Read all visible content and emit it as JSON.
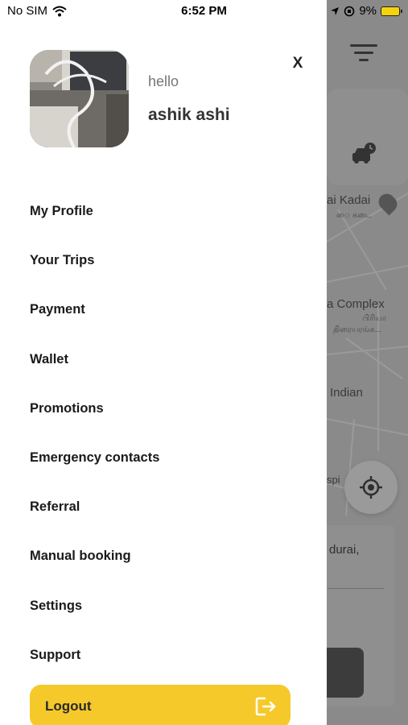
{
  "status_bar": {
    "carrier": "No SIM",
    "time": "6:52 PM",
    "battery": "9%"
  },
  "drawer": {
    "close_label": "X",
    "greeting": "hello",
    "user_name": "ashik ashi",
    "menu_items": [
      {
        "label": "My Profile"
      },
      {
        "label": "Your Trips"
      },
      {
        "label": "Payment"
      },
      {
        "label": "Wallet"
      },
      {
        "label": "Promotions"
      },
      {
        "label": "Emergency contacts"
      },
      {
        "label": "Referral"
      },
      {
        "label": "Manual booking"
      },
      {
        "label": "Settings"
      },
      {
        "label": "Support"
      }
    ],
    "logout_label": "Logout"
  },
  "map": {
    "labels": {
      "kadai": "ai Kadai",
      "kadai_sub": "ை கடை",
      "complex": "a Complex",
      "complex_sub1": "பிரியா",
      "complex_sub2": "திரையரங்க...",
      "indian": "Indian",
      "spi": "spi",
      "durai": "durai,"
    }
  },
  "colors": {
    "accent": "#f6c92b",
    "overlay": "#8a8a8a",
    "text_dark": "#1a1a1a"
  }
}
